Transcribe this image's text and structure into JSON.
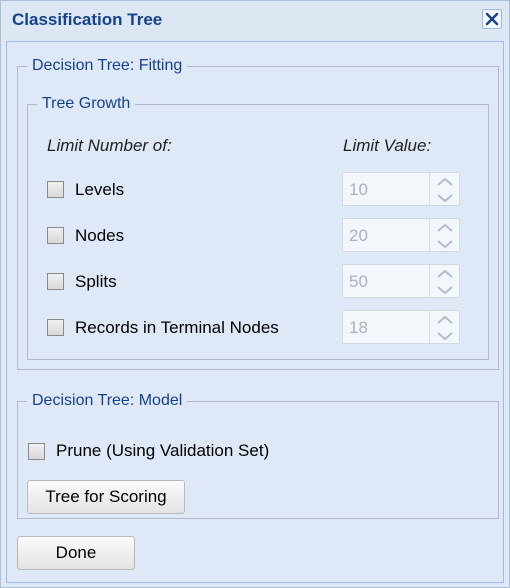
{
  "window": {
    "title": "Classification Tree"
  },
  "fitting": {
    "legend": "Decision Tree: Fitting",
    "growth": {
      "legend": "Tree Growth",
      "limit_number_label": "Limit Number of:",
      "limit_value_label": "Limit Value:",
      "rows": [
        {
          "label": "Levels",
          "checked": false,
          "value": "10"
        },
        {
          "label": "Nodes",
          "checked": false,
          "value": "20"
        },
        {
          "label": "Splits",
          "checked": false,
          "value": "50"
        },
        {
          "label": "Records in Terminal Nodes",
          "checked": false,
          "value": "18"
        }
      ]
    }
  },
  "model": {
    "legend": "Decision Tree: Model",
    "prune_label": "Prune (Using Validation Set)",
    "prune_checked": false,
    "tree_for_scoring_label": "Tree for Scoring"
  },
  "done_label": "Done",
  "colors": {
    "title": "#15428b",
    "panel": "#dfe8f6",
    "border": "#99bbe8"
  },
  "icons": {
    "close": "close-icon",
    "spin_up": "chevron-up-icon",
    "spin_down": "chevron-down-icon"
  }
}
